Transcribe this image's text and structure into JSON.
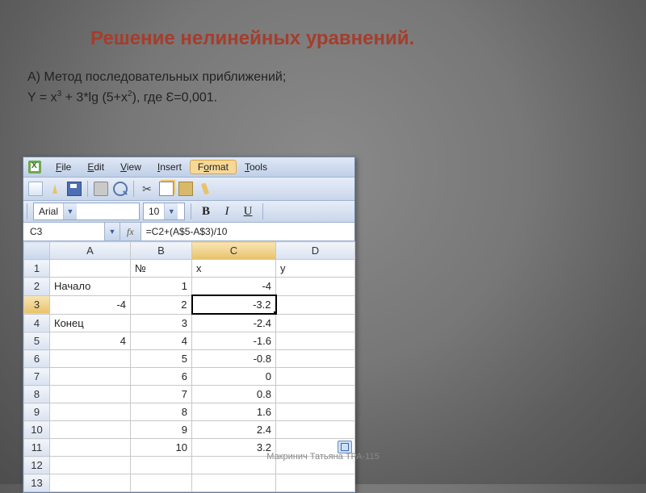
{
  "slide": {
    "title": "Решение нелинейных уравнений.",
    "line1": "А) Метод последовательных приближений;",
    "line2_html": "Y = x<sup>3</sup> + 3*lg (5+x<sup>2</sup>), где Ɛ=0,001."
  },
  "footer": "Макринич Татьяна   ТРА-115",
  "menubar": {
    "items": [
      {
        "label": "File",
        "hot": "F"
      },
      {
        "label": "Edit",
        "hot": "E"
      },
      {
        "label": "View",
        "hot": "V"
      },
      {
        "label": "Insert",
        "hot": "I"
      },
      {
        "label": "Format",
        "hot": "o",
        "active": true
      },
      {
        "label": "Tools",
        "hot": "T"
      }
    ]
  },
  "toolbar_buttons": [
    "new",
    "open",
    "save",
    "|",
    "print",
    "preview",
    "|",
    "cut",
    "copy",
    "paste",
    "brush"
  ],
  "fmt": {
    "font": "Arial",
    "size": "10",
    "b": "B",
    "i": "I",
    "u": "U"
  },
  "formula": {
    "cell": "C3",
    "fx": "fx",
    "content": "=C2+(A$5-A$3)/10"
  },
  "columns": [
    "A",
    "B",
    "C",
    "D"
  ],
  "rows": [
    {
      "n": "1",
      "A": "",
      "B": "№",
      "C": "x",
      "D": "y"
    },
    {
      "n": "2",
      "A": "Начало",
      "B": "1",
      "C": "-4",
      "D": ""
    },
    {
      "n": "3",
      "A": "-4",
      "B": "2",
      "C": "-3.2",
      "D": "",
      "active": true
    },
    {
      "n": "4",
      "A": "Конец",
      "B": "3",
      "C": "-2.4",
      "D": ""
    },
    {
      "n": "5",
      "A": "4",
      "B": "4",
      "C": "-1.6",
      "D": ""
    },
    {
      "n": "6",
      "A": "",
      "B": "5",
      "C": "-0.8",
      "D": ""
    },
    {
      "n": "7",
      "A": "",
      "B": "6",
      "C": "0",
      "D": ""
    },
    {
      "n": "8",
      "A": "",
      "B": "7",
      "C": "0.8",
      "D": ""
    },
    {
      "n": "9",
      "A": "",
      "B": "8",
      "C": "1.6",
      "D": ""
    },
    {
      "n": "10",
      "A": "",
      "B": "9",
      "C": "2.4",
      "D": ""
    },
    {
      "n": "11",
      "A": "",
      "B": "10",
      "C": "3.2",
      "D": "",
      "tag": true
    },
    {
      "n": "12",
      "A": "",
      "B": "",
      "C": "",
      "D": ""
    },
    {
      "n": "13",
      "A": "",
      "B": "",
      "C": "",
      "D": ""
    }
  ],
  "active_col": "C"
}
